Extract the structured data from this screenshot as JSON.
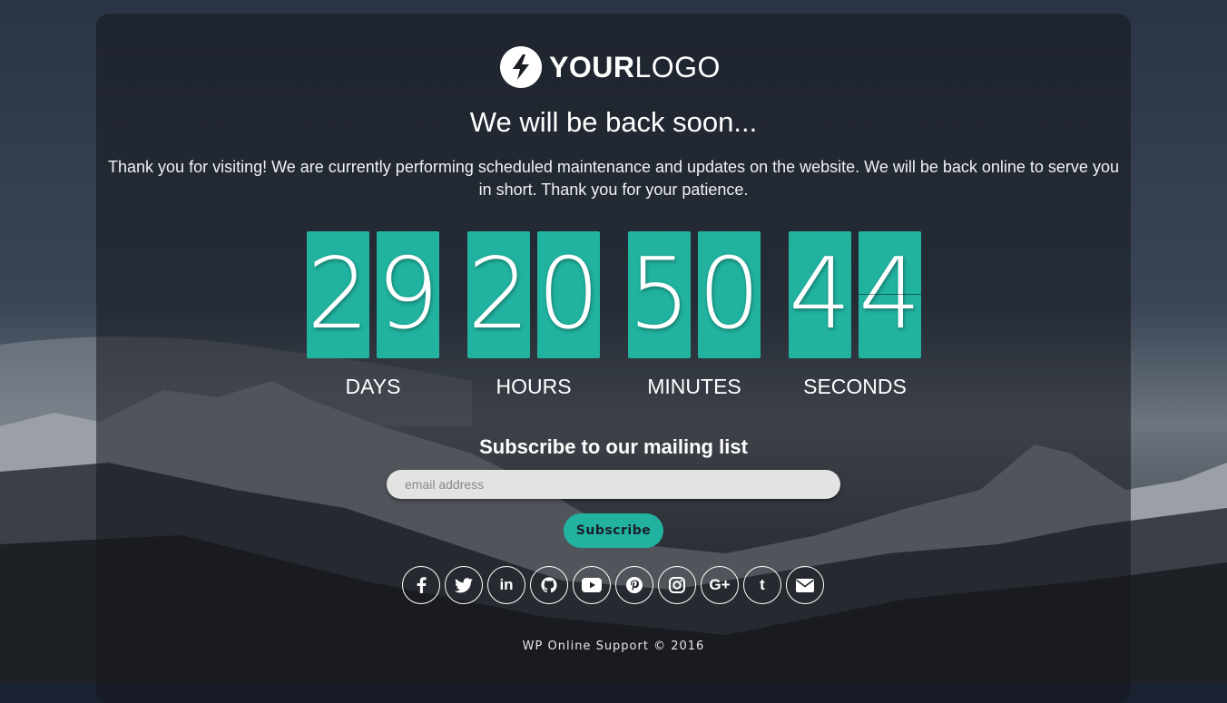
{
  "brand": {
    "logo_bold": "YOUR",
    "logo_light": "LOGO"
  },
  "heading": "We will be back soon...",
  "message": "Thank you for visiting! We are currently performing scheduled maintenance and updates on the website. We will be back online to serve you in short. Thank you for your patience.",
  "countdown": {
    "days": {
      "d1": "2",
      "d2": "9",
      "label": "DAYS"
    },
    "hours": {
      "d1": "2",
      "d2": "0",
      "label": "HOURS"
    },
    "minutes": {
      "d1": "5",
      "d2": "0",
      "label": "MINUTES"
    },
    "seconds": {
      "d1": "4",
      "d2": "4",
      "label": "SECONDS"
    }
  },
  "subscribe": {
    "title": "Subscribe to our mailing list",
    "email_placeholder": "email address",
    "email_value": "",
    "button_label": "Subscribe"
  },
  "social": {
    "icons": [
      "facebook-icon",
      "twitter-icon",
      "linkedin-icon",
      "github-icon",
      "youtube-icon",
      "pinterest-icon",
      "instagram-icon",
      "google-plus-icon",
      "tumblr-icon",
      "email-icon"
    ],
    "linkedin": "in",
    "google_plus": "G+",
    "tumblr": "t"
  },
  "footer": "WP Online Support © 2016",
  "colors": {
    "accent": "#21b3a0",
    "panel": "rgba(22,24,30,0.55)",
    "text": "#ffffff"
  }
}
